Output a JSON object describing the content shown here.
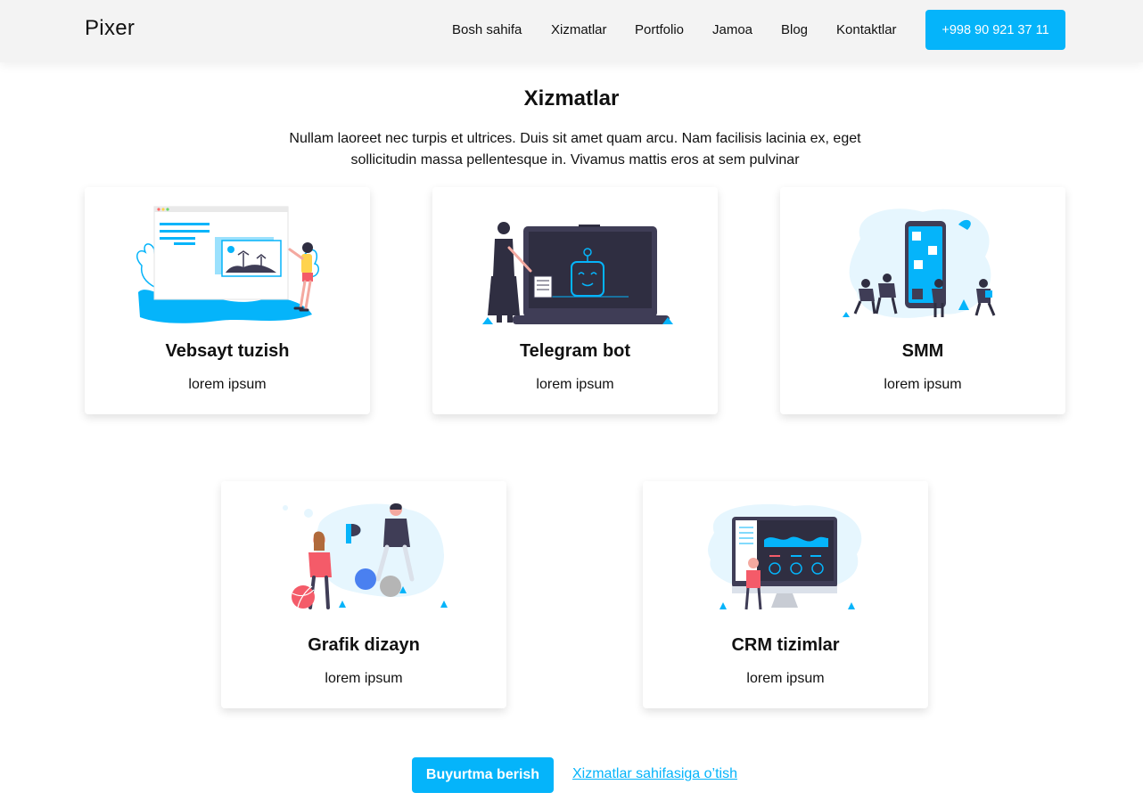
{
  "header": {
    "logo": "Pixer",
    "nav": [
      "Bosh sahifa",
      "Xizmatlar",
      "Portfolio",
      "Jamoa",
      "Blog",
      "Kontaktlar"
    ],
    "phone": "+998 90 921 37 11"
  },
  "section": {
    "title": "Xizmatlar",
    "description": "Nullam laoreet nec turpis et ultrices. Duis sit amet quam arcu. Nam facilisis lacinia ex, eget sollicitudin massa pellentesque in. Vivamus mattis eros at sem pulvinar"
  },
  "cards": [
    {
      "title": "Vebsayt tuzish",
      "subtitle": "lorem ipsum",
      "icon": "website-illustration"
    },
    {
      "title": "Telegram bot",
      "subtitle": "lorem ipsum",
      "icon": "bot-illustration"
    },
    {
      "title": "SMM",
      "subtitle": "lorem ipsum",
      "icon": "social-media-illustration"
    },
    {
      "title": "Grafik dizayn",
      "subtitle": "lorem ipsum",
      "icon": "graphic-design-illustration"
    },
    {
      "title": "CRM tizimlar",
      "subtitle": "lorem ipsum",
      "icon": "crm-illustration"
    }
  ],
  "actions": {
    "order": "Buyurtma berish",
    "services_link": "Xizmatlar sahifasiga o’tish"
  },
  "colors": {
    "accent": "#05b4fa",
    "header_bg": "#f3f3f3",
    "dark": "#3f3d56"
  }
}
